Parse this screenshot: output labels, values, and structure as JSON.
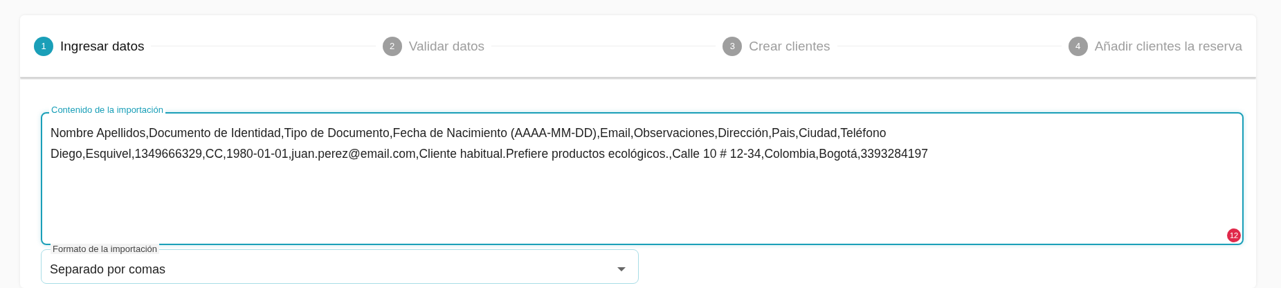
{
  "stepper": {
    "steps": [
      {
        "number": "1",
        "label": "Ingresar datos",
        "selected": true
      },
      {
        "number": "2",
        "label": "Validar datos",
        "selected": false
      },
      {
        "number": "3",
        "label": "Crear clientes",
        "selected": false
      },
      {
        "number": "4",
        "label": "Añadir clientes la reserva",
        "selected": false
      }
    ]
  },
  "import_content": {
    "label": "Contenido de la importación",
    "lines": [
      "Nombre Apellidos,Documento de Identidad,Tipo de Documento,Fecha de Nacimiento (AAAA-MM-DD),Email,Observaciones,Dirección,Pais,Ciudad,Teléfono",
      "Diego,Esquivel,1349666329,CC,1980-01-01,juan.perez@email.com,Cliente habitual.Prefiere productos ecológicos.,Calle 10 # 12-34,Colombia,Bogotá,3393284197"
    ],
    "badge": "12"
  },
  "import_format": {
    "label": "Formato de la importación",
    "value": "Separado por comas"
  }
}
